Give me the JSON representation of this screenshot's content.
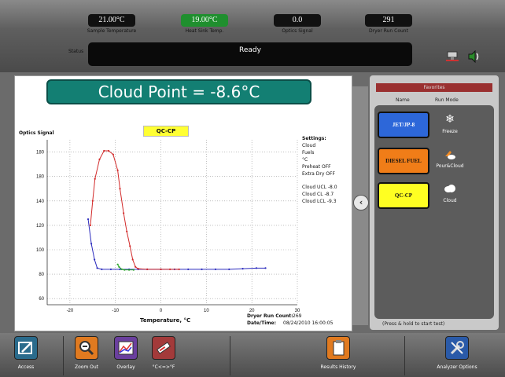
{
  "top": {
    "readouts": [
      {
        "value": "21.00°C",
        "label": "Sample Temperature"
      },
      {
        "value": "19.00°C",
        "label": "Heat Sink Temp."
      },
      {
        "value": "0.0",
        "label": "Optics Signal"
      },
      {
        "value": "291",
        "label": "Dryer Run Count"
      }
    ],
    "status_label": "Status",
    "status_text": "Ready",
    "icons": [
      "network-icon",
      "speaker-icon"
    ]
  },
  "result_banner": "Cloud Point = -8.6°C",
  "chart_badge": "QC-CP",
  "chart_data": {
    "type": "line",
    "ylabel": "Optics Signal",
    "xlabel": "Temperature, °C",
    "xlim": [
      -25,
      30
    ],
    "ylim": [
      55,
      190
    ],
    "xticks": [
      -20,
      -10,
      0,
      10,
      20,
      30
    ],
    "yticks": [
      60,
      80,
      100,
      120,
      140,
      160,
      180
    ],
    "ytick_labels": [
      "60",
      "80",
      "100",
      "120",
      "140",
      "180",
      "180"
    ],
    "grid": true,
    "series": [
      {
        "color": "#2b2bbd",
        "points": [
          [
            -16,
            125
          ],
          [
            -15.3,
            105
          ],
          [
            -14.6,
            92
          ],
          [
            -14,
            85
          ],
          [
            -13,
            84
          ],
          [
            -11,
            84
          ],
          [
            -9,
            84
          ],
          [
            -7,
            84
          ],
          [
            -5,
            84
          ],
          [
            -3,
            84
          ],
          [
            0,
            84
          ],
          [
            3,
            84
          ],
          [
            6,
            84
          ],
          [
            9,
            84
          ],
          [
            12,
            84
          ],
          [
            15,
            84
          ],
          [
            18,
            84.5
          ],
          [
            21,
            85
          ],
          [
            23,
            85
          ]
        ]
      },
      {
        "color": "#d22a2a",
        "points": [
          [
            -15.5,
            120
          ],
          [
            -15,
            140
          ],
          [
            -14.5,
            158
          ],
          [
            -13.5,
            174
          ],
          [
            -12.5,
            181
          ],
          [
            -11.5,
            181
          ],
          [
            -10.5,
            178
          ],
          [
            -9.5,
            165
          ],
          [
            -9,
            150
          ],
          [
            -8.2,
            130
          ],
          [
            -7.5,
            115
          ],
          [
            -6.8,
            103
          ],
          [
            -6.2,
            92
          ],
          [
            -5.6,
            86
          ],
          [
            -5,
            84.5
          ],
          [
            -3,
            84
          ],
          [
            0,
            84
          ],
          [
            2,
            84
          ],
          [
            4,
            84
          ]
        ]
      },
      {
        "color": "#2aa52a",
        "points": [
          [
            -9.5,
            88
          ],
          [
            -9.2,
            86
          ],
          [
            -8.6,
            84
          ],
          [
            -8,
            83.5
          ],
          [
            -7,
            83.5
          ],
          [
            -6,
            83.5
          ]
        ]
      }
    ]
  },
  "settings": {
    "title": "Settings:",
    "lines": [
      "Cloud",
      "Fuels",
      "°C",
      "Preheat OFF",
      "Extra Dry OFF"
    ],
    "limits": [
      "Cloud UCL -8.0",
      "Cloud CL -8.7",
      "Cloud LCL -9.3"
    ]
  },
  "run_info": {
    "count_label": "Dryer Run Count:",
    "count_value": "269",
    "date_label": "Date/Time:",
    "date_value": "08/24/2010 16:00:05"
  },
  "favorites": {
    "title": "Favorites",
    "col_name": "Name",
    "col_mode": "Run Mode",
    "items": [
      {
        "name": "JET/JP-8",
        "mode": "Freeze",
        "icon": "snowflake-icon",
        "bg": "#2d67d9",
        "fg": "#ffffff"
      },
      {
        "name": "DIESEL FUEL",
        "mode": "Pour&Cloud",
        "icon": "pour-cloud-icon",
        "bg": "#f07d18",
        "fg": "#111111"
      },
      {
        "name": "QC-CP",
        "mode": "Cloud",
        "icon": "cloud-icon",
        "bg": "#ffff22",
        "fg": "#111111"
      }
    ],
    "hint": "(Press & hold to start test)"
  },
  "toolbar": {
    "access": "Access",
    "zoom_out": "Zoom Out",
    "overlay": "Overlay",
    "unit_toggle": "°C<=>°F",
    "results_history": "Results History",
    "analyzer_options": "Analyzer Options"
  }
}
